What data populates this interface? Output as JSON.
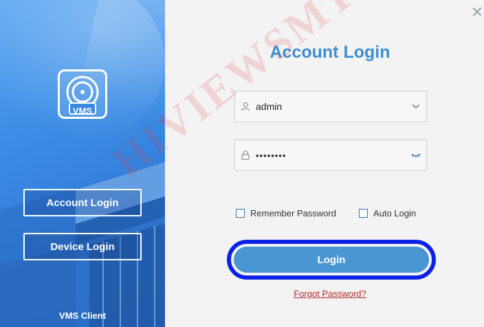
{
  "sidebar": {
    "logo_text": "VMS",
    "account_login_label": "Account Login",
    "device_login_label": "Device Login",
    "client_label": "VMS Client"
  },
  "main": {
    "title": "Account Login",
    "username_value": "admin",
    "password_value": "••••••••",
    "remember_label": "Remember Password",
    "remember_checked": false,
    "auto_login_label": "Auto Login",
    "auto_login_checked": false,
    "login_label": "Login",
    "forgot_label": "Forgot Password?"
  },
  "watermark": "HIVIEWSMT",
  "colors": {
    "accent": "#3d8fd1",
    "login_button": "#4a96d2",
    "login_outline": "#0a22e8",
    "forgot_link": "#b52a2a",
    "sidebar": "#3d8ee6"
  }
}
